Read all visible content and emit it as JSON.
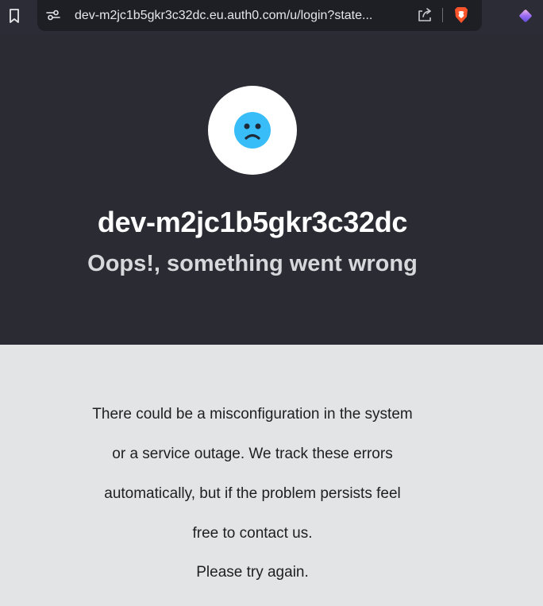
{
  "browser": {
    "url": "dev-m2jc1b5gkr3c32dc.eu.auth0.com/u/login?state..."
  },
  "page": {
    "tenant_name": "dev-m2jc1b5gkr3c32dc",
    "error_title": "Oops!, something went wrong",
    "message_lines": [
      "There could be a misconfiguration in the system",
      "or a service outage. We track these errors",
      "automatically, but if the problem persists feel",
      "free to contact us."
    ],
    "retry_text": "Please try again."
  },
  "colors": {
    "header_bg": "#2b2b34",
    "body_bg": "#e3e4e6",
    "face": "#38bdf8",
    "brave": "#fb542b"
  },
  "icons": [
    "bookmark-icon",
    "site-settings-icon",
    "share-icon",
    "brave-shield-icon",
    "extension-icon",
    "sad-face-icon"
  ]
}
